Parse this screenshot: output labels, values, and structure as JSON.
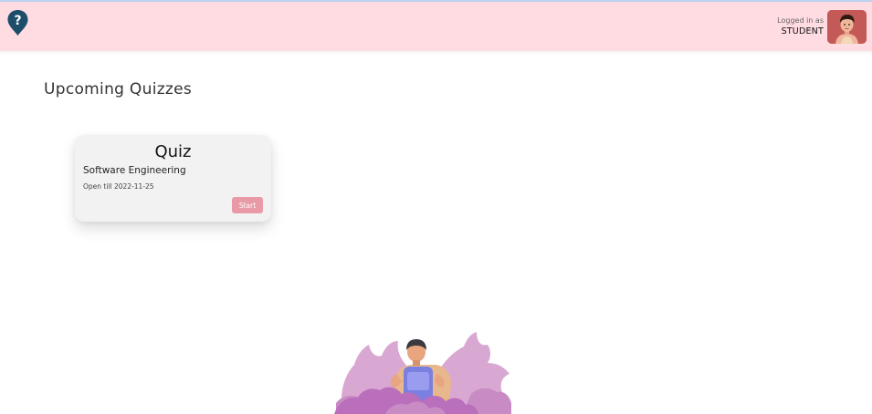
{
  "header": {
    "help_icon": "question-mark-pin-icon",
    "login_label": "Logged in as",
    "login_role": "STUDENT",
    "avatar_icon": "student-avatar",
    "colors": {
      "background": "#ffdbe2",
      "help_icon": "#1e4d6b",
      "avatar_bg": "#c45a58"
    }
  },
  "main": {
    "title": "Upcoming Quizzes",
    "quizzes": [
      {
        "title": "Quiz",
        "subject": "Software Engineering",
        "open_till": "Open till 2022-11-25",
        "start_label": "Start"
      }
    ],
    "colors": {
      "card_bg": "#f2f2f2",
      "start_button": "#e89aa6"
    }
  },
  "footer": {
    "illustration": "student-sitting-among-pink-leaves-illustration"
  }
}
